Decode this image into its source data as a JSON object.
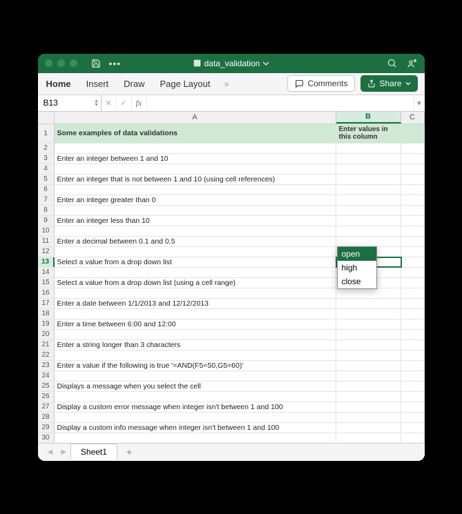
{
  "titlebar": {
    "filename": "data_validation"
  },
  "ribbon": {
    "tabs": [
      "Home",
      "Insert",
      "Draw",
      "Page Layout"
    ],
    "comments": "Comments",
    "share": "Share"
  },
  "namebox": "B13",
  "formula": "",
  "columns": {
    "A": "A",
    "B": "B",
    "C": "C"
  },
  "header_row": {
    "A": "Some examples of data validations",
    "B": "Enter values in this column"
  },
  "rows": {
    "3": "Enter an integer between 1 and 10",
    "5": "Enter an integer that is not between 1 and 10 (using cell references)",
    "7": "Enter an integer greater than 0",
    "9": "Enter an integer less than 10",
    "11": "Enter a decimal between 0.1 and 0.5",
    "13": "Select a value from a drop down list",
    "15": "Select a value from a drop down list (using a cell range)",
    "17": "Enter a date between 1/1/2013 and 12/12/2013",
    "19": "Enter a time between 6:00 and 12:00",
    "21": "Enter a string longer than 3 characters",
    "23": "Enter a value if the following is true '=AND(F5=50,G5=60)'",
    "25": "Displays a message when you select the cell",
    "27": "Display a custom error message when integer isn't between 1 and 100",
    "29": "Display a custom info message when integer isn't between 1 and 100"
  },
  "row_numbers": [
    "1",
    "2",
    "3",
    "4",
    "5",
    "6",
    "7",
    "8",
    "9",
    "10",
    "11",
    "12",
    "13",
    "14",
    "15",
    "16",
    "17",
    "18",
    "19",
    "20",
    "21",
    "22",
    "23",
    "24",
    "25",
    "26",
    "27",
    "28",
    "29",
    "30"
  ],
  "dropdown": {
    "options": [
      "open",
      "high",
      "close"
    ],
    "selected": "open"
  },
  "sheets": {
    "active": "Sheet1"
  }
}
